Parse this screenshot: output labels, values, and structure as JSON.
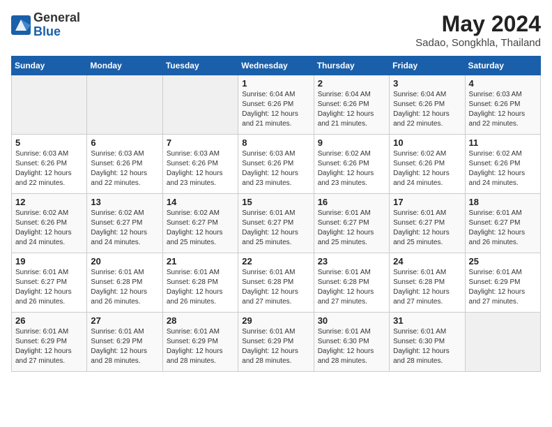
{
  "header": {
    "logo_general": "General",
    "logo_blue": "Blue",
    "month_year": "May 2024",
    "location": "Sadao, Songkhla, Thailand"
  },
  "days_of_week": [
    "Sunday",
    "Monday",
    "Tuesday",
    "Wednesday",
    "Thursday",
    "Friday",
    "Saturday"
  ],
  "weeks": [
    [
      {
        "day": "",
        "info": ""
      },
      {
        "day": "",
        "info": ""
      },
      {
        "day": "",
        "info": ""
      },
      {
        "day": "1",
        "info": "Sunrise: 6:04 AM\nSunset: 6:26 PM\nDaylight: 12 hours\nand 21 minutes."
      },
      {
        "day": "2",
        "info": "Sunrise: 6:04 AM\nSunset: 6:26 PM\nDaylight: 12 hours\nand 21 minutes."
      },
      {
        "day": "3",
        "info": "Sunrise: 6:04 AM\nSunset: 6:26 PM\nDaylight: 12 hours\nand 22 minutes."
      },
      {
        "day": "4",
        "info": "Sunrise: 6:03 AM\nSunset: 6:26 PM\nDaylight: 12 hours\nand 22 minutes."
      }
    ],
    [
      {
        "day": "5",
        "info": "Sunrise: 6:03 AM\nSunset: 6:26 PM\nDaylight: 12 hours\nand 22 minutes."
      },
      {
        "day": "6",
        "info": "Sunrise: 6:03 AM\nSunset: 6:26 PM\nDaylight: 12 hours\nand 22 minutes."
      },
      {
        "day": "7",
        "info": "Sunrise: 6:03 AM\nSunset: 6:26 PM\nDaylight: 12 hours\nand 23 minutes."
      },
      {
        "day": "8",
        "info": "Sunrise: 6:03 AM\nSunset: 6:26 PM\nDaylight: 12 hours\nand 23 minutes."
      },
      {
        "day": "9",
        "info": "Sunrise: 6:02 AM\nSunset: 6:26 PM\nDaylight: 12 hours\nand 23 minutes."
      },
      {
        "day": "10",
        "info": "Sunrise: 6:02 AM\nSunset: 6:26 PM\nDaylight: 12 hours\nand 24 minutes."
      },
      {
        "day": "11",
        "info": "Sunrise: 6:02 AM\nSunset: 6:26 PM\nDaylight: 12 hours\nand 24 minutes."
      }
    ],
    [
      {
        "day": "12",
        "info": "Sunrise: 6:02 AM\nSunset: 6:26 PM\nDaylight: 12 hours\nand 24 minutes."
      },
      {
        "day": "13",
        "info": "Sunrise: 6:02 AM\nSunset: 6:27 PM\nDaylight: 12 hours\nand 24 minutes."
      },
      {
        "day": "14",
        "info": "Sunrise: 6:02 AM\nSunset: 6:27 PM\nDaylight: 12 hours\nand 25 minutes."
      },
      {
        "day": "15",
        "info": "Sunrise: 6:01 AM\nSunset: 6:27 PM\nDaylight: 12 hours\nand 25 minutes."
      },
      {
        "day": "16",
        "info": "Sunrise: 6:01 AM\nSunset: 6:27 PM\nDaylight: 12 hours\nand 25 minutes."
      },
      {
        "day": "17",
        "info": "Sunrise: 6:01 AM\nSunset: 6:27 PM\nDaylight: 12 hours\nand 25 minutes."
      },
      {
        "day": "18",
        "info": "Sunrise: 6:01 AM\nSunset: 6:27 PM\nDaylight: 12 hours\nand 26 minutes."
      }
    ],
    [
      {
        "day": "19",
        "info": "Sunrise: 6:01 AM\nSunset: 6:27 PM\nDaylight: 12 hours\nand 26 minutes."
      },
      {
        "day": "20",
        "info": "Sunrise: 6:01 AM\nSunset: 6:28 PM\nDaylight: 12 hours\nand 26 minutes."
      },
      {
        "day": "21",
        "info": "Sunrise: 6:01 AM\nSunset: 6:28 PM\nDaylight: 12 hours\nand 26 minutes."
      },
      {
        "day": "22",
        "info": "Sunrise: 6:01 AM\nSunset: 6:28 PM\nDaylight: 12 hours\nand 27 minutes."
      },
      {
        "day": "23",
        "info": "Sunrise: 6:01 AM\nSunset: 6:28 PM\nDaylight: 12 hours\nand 27 minutes."
      },
      {
        "day": "24",
        "info": "Sunrise: 6:01 AM\nSunset: 6:28 PM\nDaylight: 12 hours\nand 27 minutes."
      },
      {
        "day": "25",
        "info": "Sunrise: 6:01 AM\nSunset: 6:29 PM\nDaylight: 12 hours\nand 27 minutes."
      }
    ],
    [
      {
        "day": "26",
        "info": "Sunrise: 6:01 AM\nSunset: 6:29 PM\nDaylight: 12 hours\nand 27 minutes."
      },
      {
        "day": "27",
        "info": "Sunrise: 6:01 AM\nSunset: 6:29 PM\nDaylight: 12 hours\nand 28 minutes."
      },
      {
        "day": "28",
        "info": "Sunrise: 6:01 AM\nSunset: 6:29 PM\nDaylight: 12 hours\nand 28 minutes."
      },
      {
        "day": "29",
        "info": "Sunrise: 6:01 AM\nSunset: 6:29 PM\nDaylight: 12 hours\nand 28 minutes."
      },
      {
        "day": "30",
        "info": "Sunrise: 6:01 AM\nSunset: 6:30 PM\nDaylight: 12 hours\nand 28 minutes."
      },
      {
        "day": "31",
        "info": "Sunrise: 6:01 AM\nSunset: 6:30 PM\nDaylight: 12 hours\nand 28 minutes."
      },
      {
        "day": "",
        "info": ""
      }
    ]
  ]
}
